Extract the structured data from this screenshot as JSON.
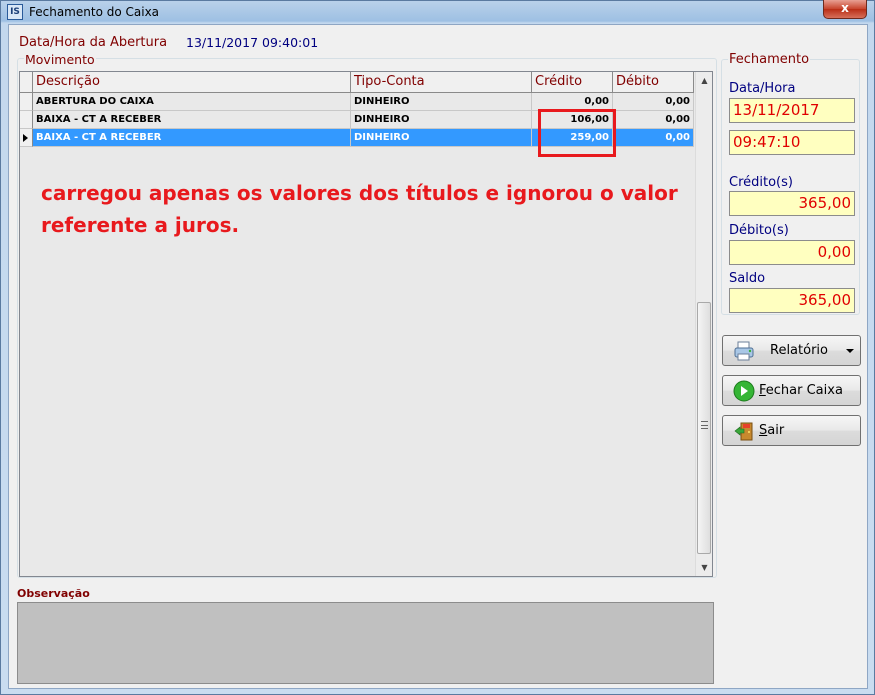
{
  "window": {
    "icon_text": "IS",
    "title": "Fechamento do Caixa",
    "close_glyph": "x"
  },
  "abertura": {
    "label": "Data/Hora da Abertura",
    "value": "13/11/2017  09:40:01"
  },
  "movimento": {
    "title": "Movimento",
    "columns": [
      "Descrição",
      "Tipo-Conta",
      "Crédito",
      "Débito"
    ],
    "rows": [
      {
        "descricao": "ABERTURA DO CAIXA",
        "tipo_conta": "DINHEIRO",
        "credito": "0,00",
        "debito": "0,00",
        "selected": false
      },
      {
        "descricao": "BAIXA - CT A RECEBER",
        "tipo_conta": "DINHEIRO",
        "credito": "106,00",
        "debito": "0,00",
        "selected": false
      },
      {
        "descricao": "BAIXA - CT A RECEBER",
        "tipo_conta": "DINHEIRO",
        "credito": "259,00",
        "debito": "0,00",
        "selected": true
      }
    ]
  },
  "annotation": {
    "text": "carregou apenas os valores dos títulos e ignorou o valor referente a juros.",
    "color": "#e8191d"
  },
  "observacao": {
    "label": "Observação",
    "value": ""
  },
  "fechamento": {
    "title": "Fechamento",
    "data_hora_label": "Data/Hora",
    "date": "13/11/2017",
    "time": "09:47:10",
    "credito_label": "Crédito(s)",
    "credito": "365,00",
    "debito_label": "Débito(s)",
    "debito": "0,00",
    "saldo_label": "Saldo",
    "saldo": "365,00"
  },
  "buttons": {
    "relatorio": "Relatório",
    "fechar_first": "F",
    "fechar_rest": "echar Caixa",
    "sair_first": "S",
    "sair_rest": "air"
  },
  "icons": {
    "relatorio": "printer-icon",
    "fechar": "green-arrow-icon",
    "sair": "exit-door-icon"
  },
  "colors": {
    "label_maroon": "#800000",
    "label_navy": "#000080",
    "selection": "#3399ff",
    "value_red": "#e00000",
    "field_yellow": "#ffffc0"
  }
}
